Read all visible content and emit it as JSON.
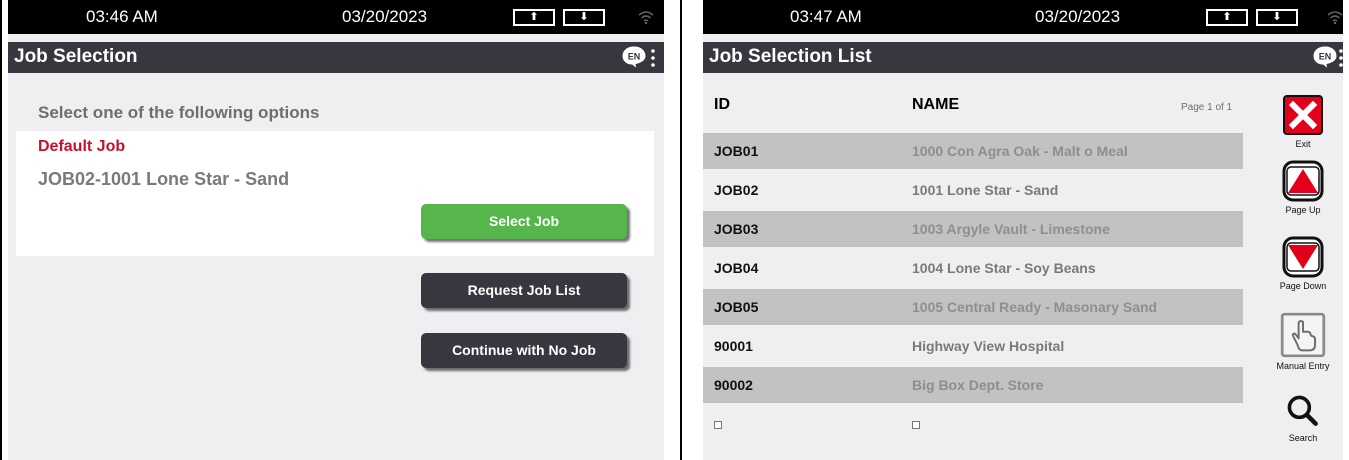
{
  "left": {
    "status": {
      "time": "03:46 AM",
      "date": "03/20/2023",
      "up_arrow": "⬆",
      "down_arrow": "⬇"
    },
    "title": "Job Selection",
    "prompt": "Select one of the following options",
    "default_job_label": "Default Job",
    "current_job": "JOB02-1001 Lone Star - Sand",
    "buttons": {
      "select_job": "Select Job",
      "request_job_list": "Request Job List",
      "continue_no_job": "Continue with No Job"
    }
  },
  "right": {
    "status": {
      "time": "03:47 AM",
      "date": "03/20/2023",
      "up_arrow": "⬆",
      "down_arrow": "⬇"
    },
    "title": "Job Selection List",
    "columns": {
      "id": "ID",
      "name": "NAME"
    },
    "page_indicator": "Page 1 of 1",
    "rows": [
      {
        "id": "JOB01",
        "name": "1000 Con Agra Oak - Malt o Meal"
      },
      {
        "id": "JOB02",
        "name": "1001 Lone Star - Sand"
      },
      {
        "id": "JOB03",
        "name": "1003 Argyle Vault - Limestone"
      },
      {
        "id": "JOB04",
        "name": "1004 Lone Star - Soy Beans"
      },
      {
        "id": "JOB05",
        "name": "1005 Central Ready - Masonary Sand"
      },
      {
        "id": "90001",
        "name": "Highway View Hospital"
      },
      {
        "id": "90002",
        "name": "Big Box Dept. Store"
      }
    ],
    "side_buttons": {
      "exit": "Exit",
      "page_up": "Page Up",
      "page_down": "Page Down",
      "manual_entry": "Manual Entry",
      "search": "Search"
    }
  },
  "icons": {
    "language": "language-en-icon",
    "menu": "kebab-menu-icon",
    "wifi": "wifi-icon",
    "exit": "close-icon",
    "page_up": "triangle-up-icon",
    "page_down": "triangle-down-icon",
    "manual_entry": "hand-pointer-icon",
    "search": "search-icon"
  },
  "colors": {
    "header_bg": "#37373f",
    "accent_green": "#56b54b",
    "accent_red": "#e2001a",
    "default_job_red": "#c8102e",
    "row_shade": "#c2c2c2",
    "panel_bg": "#efeff1"
  }
}
